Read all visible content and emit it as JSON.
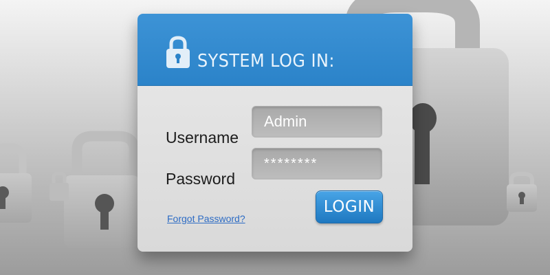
{
  "dialog": {
    "title": "SYSTEM LOG IN:",
    "username_label": "Username",
    "password_label": "Password",
    "username_value": "Admin",
    "password_value": "********",
    "forgot_password_link": "Forgot Password?",
    "login_button": "LOGIN"
  },
  "icons": {
    "header": "lock-icon",
    "background": "padlock-icon"
  },
  "colors": {
    "header_blue": "#2b83c9",
    "button_blue": "#1e78c0",
    "link_blue": "#2c6bc4",
    "card_gray": "#e0e0e0",
    "field_gray": "#b3b3b3"
  }
}
